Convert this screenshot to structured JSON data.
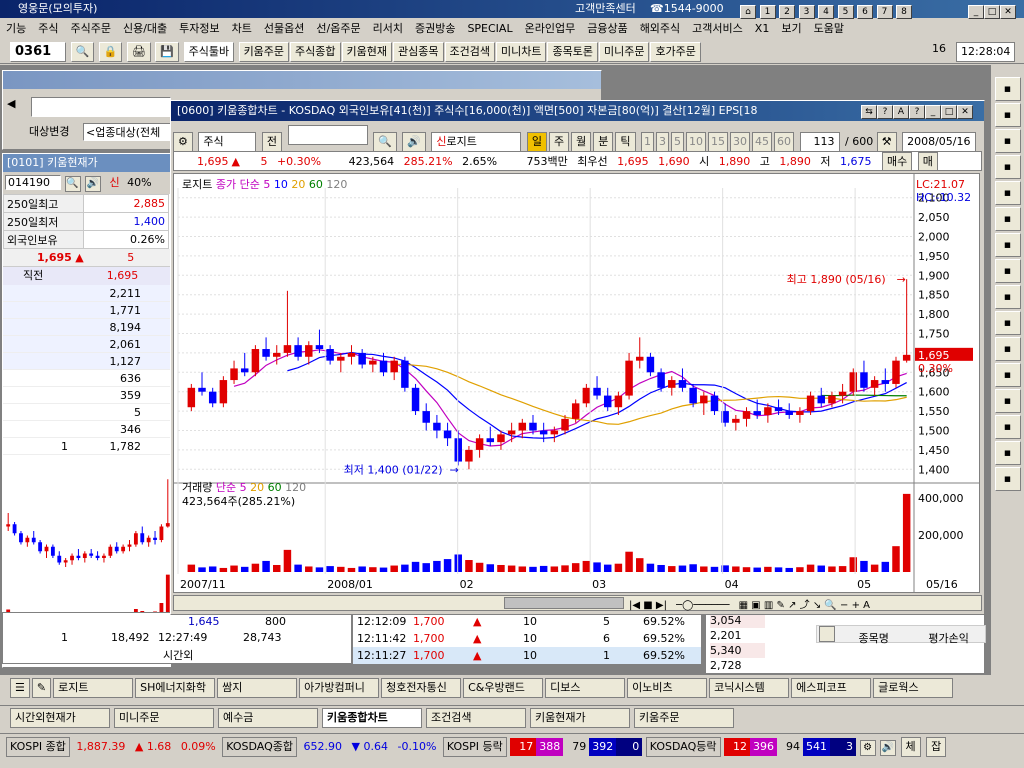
{
  "app": {
    "title": "영웅문(모의투자)",
    "center": "고객만족센터",
    "phone": "☎1544-9000"
  },
  "menu": [
    "기능",
    "주식",
    "주식주문",
    "신용/대출",
    "투자정보",
    "차트",
    "선물옵션",
    "선/옵주문",
    "리서치",
    "증권방송",
    "SPECIAL",
    "온라인업무",
    "금융상품",
    "해외주식",
    "고객서비스",
    "X1",
    "보기",
    "도움말"
  ],
  "toolbar": {
    "screen_no": "0361",
    "toolbar_sel": "주식툴바",
    "buttons": [
      "키움주문",
      "주식종합",
      "키움현재",
      "관심종목",
      "조건검색",
      "미니차트",
      "종목토론",
      "미니주문",
      "호가주문"
    ],
    "page_no": "16",
    "clock": "12:28:04"
  },
  "left_panel": {
    "target_label": "대상변경",
    "target_value": "<업종대상(전체",
    "title": "[0101] 키움현재가",
    "code": "014190",
    "credit": "신",
    "pct": "40%",
    "rows": [
      {
        "label": "250일최고",
        "value": "2,885"
      },
      {
        "label": "250일최저",
        "value": "1,400"
      },
      {
        "label": "외국인보유",
        "value": "0.26%"
      }
    ],
    "price": "1,695",
    "change": "5",
    "prev_label": "직전",
    "prev_value": "1,695",
    "depth": [
      "2,211",
      "1,771",
      "8,194",
      "2,061",
      "1,127",
      "636",
      "359",
      "5",
      "346",
      "1,782"
    ],
    "depth_left": "1",
    "bottom": {
      "a": "1",
      "b": "18,492",
      "time": "12:27:49",
      "vol": "28,743",
      "label": "시간외",
      "price_low": "1,645",
      "qty": "800"
    }
  },
  "chart_window": {
    "title": "[0600] 키움종합차트 - KOSDAQ 외국인보유[41(천)] 주식수[16,000(천)] 액면[500] 자본금[80(억)] 결산[12월] EPS[18",
    "type_sel": "주식",
    "prev_btn": "전",
    "logit": "로지트",
    "credit": "신",
    "periods": [
      "일",
      "주",
      "월",
      "분",
      "틱"
    ],
    "minute_nums": [
      "1",
      "3",
      "5",
      "10",
      "15",
      "30",
      "45",
      "60"
    ],
    "count": "113",
    "count_total": "/ 600",
    "date": "2008/05/16",
    "quote": {
      "price": "1,695",
      "change": "5",
      "rate": "+0.30%",
      "vol": "423,564",
      "vol_rate": "285.21%",
      "turnover": "2.65%",
      "amount": "753백만",
      "best_label": "최우선",
      "best_ask": "1,695",
      "best_bid": "1,690",
      "open_label": "시",
      "open": "1,890",
      "high_label": "고",
      "high": "1,890",
      "low_label": "저",
      "low": "1,675",
      "buy": "매수",
      "sell": "매"
    },
    "legend": {
      "name": "로지트",
      "ma": "종가 단순",
      "ma_periods": [
        "5",
        "10",
        "20",
        "60",
        "120"
      ]
    },
    "lc": "LC:21.07",
    "hc": "HC:-10.32",
    "max_label": "최고 1,890 (05/16)",
    "min_label": "최저 1,400 (01/22)",
    "price_tag": "1,695",
    "price_tag2": "0.30%",
    "y_ticks": [
      "2,100",
      "2,050",
      "2,000",
      "1,950",
      "1,900",
      "1,850",
      "1,800",
      "1,750",
      "1,700",
      "1,650",
      "1,600",
      "1,550",
      "1,500",
      "1,450",
      "1,400"
    ],
    "vol_legend": {
      "name": "거래량",
      "ma": "단순",
      "periods": [
        "5",
        "20",
        "60",
        "120"
      ],
      "value": "423,564주(285.21%)"
    },
    "vol_ticks": [
      "400,000",
      "200,000"
    ],
    "x_labels": [
      "2007/11",
      "2008/01",
      "02",
      "03",
      "04",
      "05",
      "05/16"
    ]
  },
  "right_bottom": {
    "header": [
      "종목명",
      "평가손익"
    ],
    "values": [
      "3,054",
      "2,201",
      "5,340",
      "2,728"
    ]
  },
  "trades": [
    {
      "time": "12:12:09",
      "price": "1,700",
      "qty": "10",
      "n": "5",
      "rate": "69.52%"
    },
    {
      "time": "12:11:42",
      "price": "1,700",
      "qty": "10",
      "n": "6",
      "rate": "69.52%"
    },
    {
      "time": "12:11:27",
      "price": "1,700",
      "qty": "10",
      "n": "1",
      "rate": "69.52%"
    }
  ],
  "stock_tabs": [
    "로지트",
    "SH에너지화학",
    "쌈지",
    "아가방컴퍼니",
    "청호전자통신",
    "C&우방랜드",
    "디보스",
    "이노비츠",
    "코닉시스템",
    "에스피코프",
    "글로웍스"
  ],
  "task_tabs": [
    "시간외현재가",
    "미니주문",
    "예수금",
    "키움종합차트",
    "조건검색",
    "키움현재가",
    "키움주문"
  ],
  "status": {
    "kospi_label": "KOSPI 종합",
    "kospi": "1,887.39",
    "kospi_chg": "▲ 1.68",
    "kospi_pct": "0.09%",
    "kosdaq_label": "KOSDAQ종합",
    "kosdaq": "652.90",
    "kosdaq_chg": "▼ 0.64",
    "kosdaq_pct": "-0.10%",
    "kospi_ad_label": "KOSPI 등락",
    "kospi_ad": [
      "17",
      "388",
      "79",
      "392",
      "0"
    ],
    "kosdaq_ad_label": "KOSDAQ등락",
    "kosdaq_ad": [
      "12",
      "396",
      "94",
      "541",
      "3"
    ],
    "btn1": "체",
    "btn2": "잡"
  },
  "chart_data": {
    "type": "candlestick",
    "title": "[0600] 키움종합차트",
    "x_labels": [
      "2007/11",
      "2008/01",
      "02",
      "03",
      "04",
      "05",
      "05/16"
    ],
    "ylim": [
      1375,
      2125
    ],
    "max": {
      "label": "최고 1,890 (05/16)",
      "value": 1890
    },
    "min": {
      "label": "최저 1,400 (01/22)",
      "value": 1400
    },
    "last": 1695,
    "candles": [
      [
        1560,
        1620,
        1550,
        1610
      ],
      [
        1610,
        1650,
        1590,
        1600
      ],
      [
        1600,
        1610,
        1560,
        1570
      ],
      [
        1570,
        1640,
        1560,
        1630
      ],
      [
        1630,
        1680,
        1620,
        1660
      ],
      [
        1660,
        1700,
        1640,
        1650
      ],
      [
        1650,
        1720,
        1640,
        1710
      ],
      [
        1710,
        1740,
        1680,
        1690
      ],
      [
        1690,
        1720,
        1670,
        1700
      ],
      [
        1700,
        1860,
        1690,
        1720
      ],
      [
        1720,
        1740,
        1680,
        1690
      ],
      [
        1690,
        1730,
        1670,
        1720
      ],
      [
        1720,
        1760,
        1700,
        1710
      ],
      [
        1710,
        1720,
        1670,
        1680
      ],
      [
        1680,
        1700,
        1650,
        1690
      ],
      [
        1690,
        1720,
        1670,
        1700
      ],
      [
        1700,
        1710,
        1660,
        1670
      ],
      [
        1670,
        1690,
        1650,
        1680
      ],
      [
        1680,
        1700,
        1640,
        1650
      ],
      [
        1650,
        1690,
        1630,
        1680
      ],
      [
        1680,
        1690,
        1600,
        1610
      ],
      [
        1610,
        1620,
        1540,
        1550
      ],
      [
        1550,
        1570,
        1500,
        1520
      ],
      [
        1520,
        1540,
        1480,
        1500
      ],
      [
        1500,
        1520,
        1460,
        1480
      ],
      [
        1480,
        1500,
        1410,
        1420
      ],
      [
        1420,
        1460,
        1400,
        1450
      ],
      [
        1450,
        1490,
        1430,
        1480
      ],
      [
        1480,
        1510,
        1460,
        1470
      ],
      [
        1470,
        1500,
        1450,
        1490
      ],
      [
        1490,
        1520,
        1470,
        1500
      ],
      [
        1500,
        1530,
        1480,
        1520
      ],
      [
        1520,
        1540,
        1490,
        1500
      ],
      [
        1500,
        1520,
        1470,
        1490
      ],
      [
        1490,
        1510,
        1470,
        1500
      ],
      [
        1500,
        1540,
        1490,
        1530
      ],
      [
        1530,
        1580,
        1520,
        1570
      ],
      [
        1570,
        1620,
        1560,
        1610
      ],
      [
        1610,
        1640,
        1580,
        1590
      ],
      [
        1590,
        1610,
        1550,
        1560
      ],
      [
        1560,
        1600,
        1540,
        1590
      ],
      [
        1590,
        1700,
        1580,
        1680
      ],
      [
        1680,
        1740,
        1660,
        1690
      ],
      [
        1690,
        1700,
        1640,
        1650
      ],
      [
        1650,
        1660,
        1600,
        1610
      ],
      [
        1610,
        1640,
        1590,
        1630
      ],
      [
        1630,
        1660,
        1600,
        1610
      ],
      [
        1610,
        1620,
        1560,
        1570
      ],
      [
        1570,
        1600,
        1540,
        1590
      ],
      [
        1590,
        1600,
        1540,
        1550
      ],
      [
        1550,
        1570,
        1510,
        1520
      ],
      [
        1520,
        1540,
        1500,
        1530
      ],
      [
        1530,
        1560,
        1510,
        1550
      ],
      [
        1550,
        1580,
        1530,
        1540
      ],
      [
        1540,
        1570,
        1520,
        1560
      ],
      [
        1560,
        1580,
        1540,
        1550
      ],
      [
        1550,
        1570,
        1530,
        1540
      ],
      [
        1540,
        1560,
        1520,
        1550
      ],
      [
        1550,
        1600,
        1540,
        1590
      ],
      [
        1590,
        1610,
        1560,
        1570
      ],
      [
        1570,
        1600,
        1560,
        1590
      ],
      [
        1590,
        1620,
        1570,
        1600
      ],
      [
        1600,
        1660,
        1590,
        1650
      ],
      [
        1650,
        1680,
        1600,
        1610
      ],
      [
        1610,
        1640,
        1590,
        1630
      ],
      [
        1630,
        1660,
        1600,
        1620
      ],
      [
        1620,
        1690,
        1610,
        1680
      ],
      [
        1680,
        1890,
        1675,
        1695
      ]
    ],
    "volume_ylim": [
      0,
      450000
    ],
    "volume": [
      40000,
      25000,
      30000,
      22000,
      35000,
      28000,
      45000,
      60000,
      38000,
      120000,
      40000,
      30000,
      25000,
      32000,
      28000,
      22000,
      30000,
      26000,
      24000,
      35000,
      40000,
      55000,
      48000,
      60000,
      70000,
      95000,
      65000,
      50000,
      42000,
      38000,
      35000,
      30000,
      28000,
      33000,
      30000,
      36000,
      48000,
      60000,
      52000,
      40000,
      45000,
      110000,
      75000,
      45000,
      38000,
      32000,
      35000,
      42000,
      30000,
      28000,
      36000,
      30000,
      26000,
      24000,
      28000,
      25000,
      22000,
      26000,
      40000,
      35000,
      30000,
      32000,
      80000,
      60000,
      40000,
      55000,
      140000,
      423564
    ]
  }
}
